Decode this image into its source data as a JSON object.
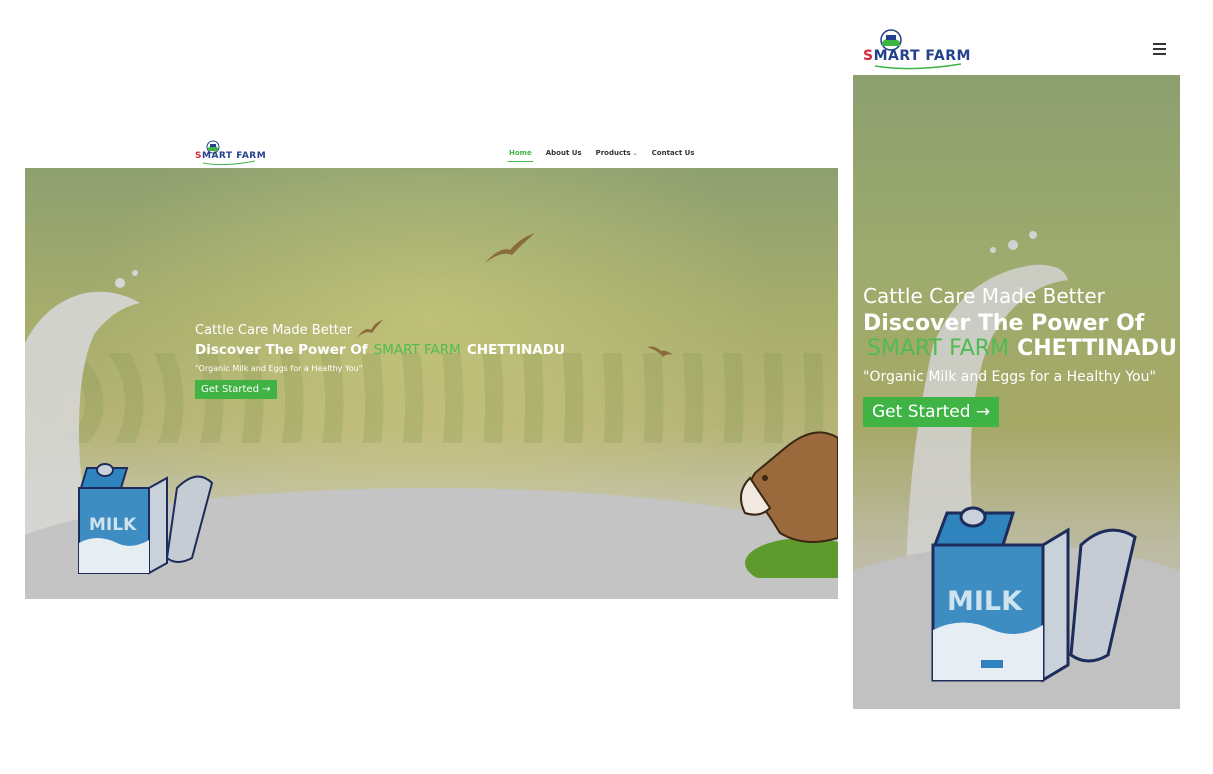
{
  "brand": {
    "first_letter": "S",
    "rest_of_name": "MART FARM"
  },
  "nav": {
    "items": [
      {
        "label": "Home",
        "active": true
      },
      {
        "label": "About Us",
        "active": false
      },
      {
        "label": "Products",
        "active": false,
        "has_dropdown": true
      },
      {
        "label": "Contact Us",
        "active": false
      }
    ]
  },
  "hero": {
    "tagline": "Cattle Care Made Better",
    "headline_prefix": "Discover The Power Of",
    "headline_brand": "SMART FARM",
    "headline_suffix": "CHETTINADU",
    "subtitle": "\"Organic Milk and Eggs for a Healthy You\"",
    "cta_label": "Get Started →",
    "milk_carton_label": "MILK"
  },
  "colors": {
    "accent_green": "#3fb343",
    "brand_red": "#d8283a",
    "brand_blue": "#24418e",
    "carton_blue": "#3d8dc2"
  },
  "icons": {
    "menu": "hamburger-icon",
    "dropdown": "chevron-down-icon",
    "cta": "arrow-right-icon"
  }
}
